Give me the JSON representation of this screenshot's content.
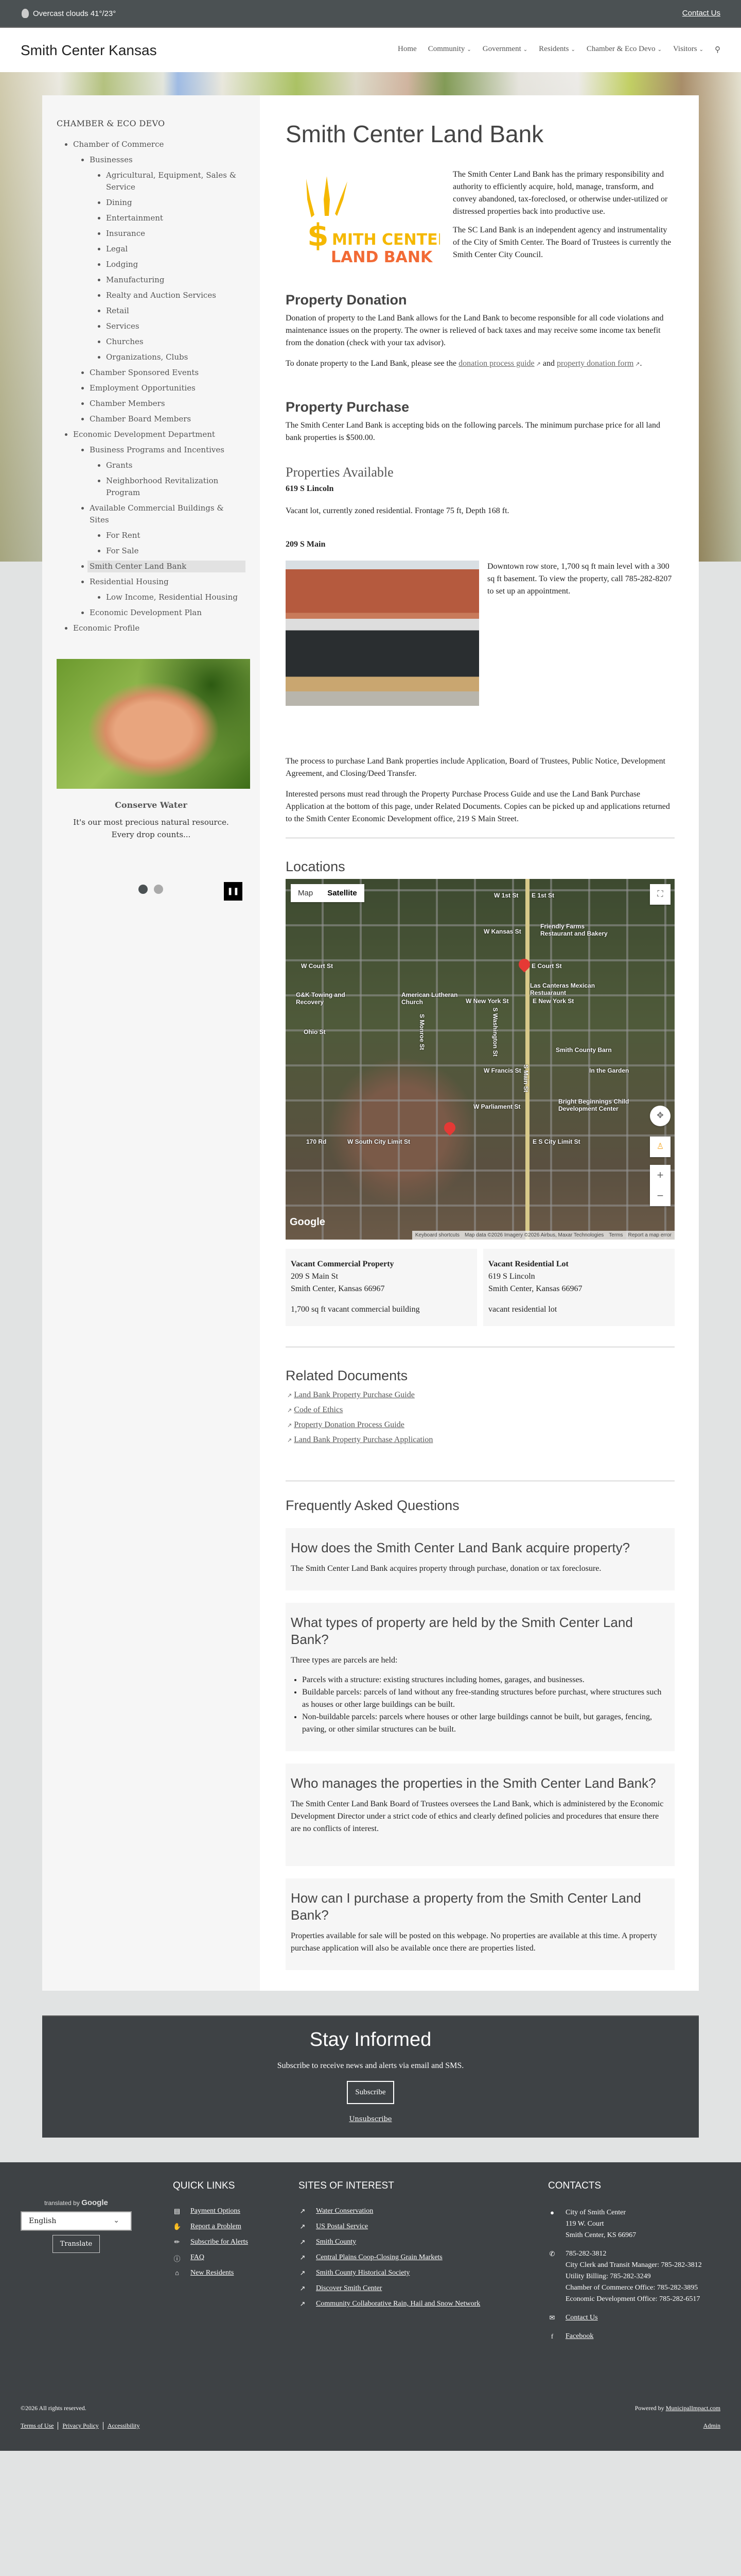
{
  "topbar": {
    "weather": "Overcast clouds 41°/23°",
    "contact": "Contact Us"
  },
  "header": {
    "title": "Smith Center Kansas",
    "nav": [
      "Home",
      "Community",
      "Government",
      "Residents",
      "Chamber & Eco Devo",
      "Visitors"
    ]
  },
  "sidebar": {
    "title": "CHAMBER & ECO DEVO",
    "l1": [
      "Chamber of Commerce",
      "Economic Development Department",
      "Economic Profile"
    ],
    "chamber": [
      "Businesses",
      "Chamber Sponsored Events",
      "Employment Opportunities",
      "Chamber Members",
      "Chamber Board Members"
    ],
    "businesses": [
      "Agricultural, Equipment, Sales & Service",
      "Dining",
      "Entertainment",
      "Insurance",
      "Legal",
      "Lodging",
      "Manufacturing",
      "Realty and Auction Services",
      "Retail",
      "Services",
      "Churches",
      "Organizations, Clubs"
    ],
    "eco": [
      "Business Programs and Incentives",
      "Available Commercial Buildings & Sites",
      "Smith Center Land Bank",
      "Residential Housing",
      "Economic Development Plan"
    ],
    "programs": [
      "Grants",
      "Neighborhood Revitalization Program"
    ],
    "sites": [
      "For Rent",
      "For Sale"
    ],
    "housing": [
      "Low Income, Residential Housing"
    ],
    "promo": {
      "title": "Conserve Water",
      "text": "It's our most precious natural resource.  Every drop counts..."
    },
    "slides": {
      "count": 2,
      "active": 1
    }
  },
  "main": {
    "title": "Smith Center Land Bank",
    "logo": {
      "line1": "SMITH CENTER",
      "line2": "LAND BANK"
    },
    "intro": [
      "The Smith Center Land Bank has the primary responsibility and authority to efficiently acquire, hold, manage, transform, and convey abandoned, tax-foreclosed, or otherwise under-utilized or distressed properties back into productive use.",
      "The SC Land Bank is an independent agency and instrumentality of the City of Smith Center. The Board of Trustees is currently the Smith Center City Council."
    ],
    "donation": {
      "heading": "Property Donation",
      "p1": "Donation of property to the Land Bank allows for the Land Bank to become responsible for all code violations and maintenance issues on the property. The owner is relieved of back taxes and may receive some income tax benefit from the donation (check with your tax advisor).",
      "p2a": "To donate property to the Land Bank, please see the ",
      "link1": "donation process guide",
      "p2b": " and ",
      "link2": "property donation form",
      "p2c": "."
    },
    "purchase": {
      "heading": "Property Purchase",
      "p1": "The Smith Center Land Bank is accepting bids on the following parcels. The minimum purchase price for all land bank properties is $500.00."
    },
    "available": {
      "heading": "Properties Available",
      "p1": {
        "addr": "619 S Lincoln",
        "desc": "Vacant lot, currently zoned residential. Frontage 75 ft, Depth 168 ft."
      },
      "p2": {
        "addr": "209 S Main",
        "desc": "Downtown row store, 1,700 sq ft main level with a 300 sq ft basement. To view the property, call 785-282-8207 to set up an appointment."
      }
    },
    "process": [
      "The process to purchase Land Bank properties include Application, Board of Trustees, Public Notice, Development Agreement, and Closing/Deed Transfer.",
      "Interested persons must read through the Property Purchase Process Guide and use the Land Bank Purchase Application at the bottom of this page, under Related Documents. Copies can be picked up and applications returned to the Smith Center Economic Development office, 219 S Main Street."
    ],
    "locations": {
      "heading": "Locations",
      "map": {
        "type_map": "Map",
        "type_sat": "Satellite",
        "google": "Google",
        "attr": [
          "Keyboard shortcuts",
          "Map data ©2026 Imagery ©2026 Airbus, Maxar Technologies",
          "Terms",
          "Report a map error"
        ],
        "labels": [
          "W 1st St",
          "E 1st St",
          "W Kansas St",
          "Friendly Farms Restaurant and Bakery",
          "W Court St",
          "E Court St",
          "Las Canteras Mexican Restuaraunt",
          "G&K Towing and Recovery",
          "American Lutheran Church",
          "W New York St",
          "E New York St",
          "Ohio St",
          "Smith County Barn",
          "W Francis St",
          "In the Garden",
          "W Parliament St",
          "Bright Beginnings Child Development Center",
          "W South City Limit St",
          "E S City Limit St",
          "170 Rd",
          "S Main St",
          "S Monroe St",
          "S Washington St"
        ]
      },
      "cards": [
        {
          "name": "Vacant Commercial Property",
          "addr1": "209 S Main St",
          "addr2": "Smith Center, Kansas 66967",
          "desc": "1,700 sq ft vacant commercial building"
        },
        {
          "name": "Vacant Residential Lot",
          "addr1": "619 S Lincoln",
          "addr2": "Smith Center, Kansas 66967",
          "desc": "vacant residential lot"
        }
      ]
    },
    "docs": {
      "heading": "Related Documents",
      "items": [
        "Land Bank Property Purchase Guide",
        "Code of Ethics",
        "Property Donation Process Guide",
        "Land Bank Property Purchase Application"
      ]
    },
    "faq": {
      "heading": "Frequently Asked Questions",
      "items": [
        {
          "q": "How does the Smith Center Land Bank acquire property?",
          "a": "The Smith Center Land Bank acquires property through purchase, donation or tax foreclosure."
        },
        {
          "q": "What types of property are held by the Smith Center Land Bank?",
          "a": "Three types are parcels are held:",
          "list": [
            "Parcels with a structure: existing structures including homes, garages, and businesses.",
            "Buildable parcels: parcels of land without any free-standing structures before purchast, where structures such as houses or other large buildings can be built.",
            "Non-buildable parcels: parcels where houses or other large buildings cannot be built, but garages, fencing, paving, or other similar structures can be built."
          ]
        },
        {
          "q": "Who manages the properties in the Smith Center Land Bank?",
          "a": "The Smith Center Land Bank Board of Trustees oversees the Land Bank, which is administered by the Economic Development Director under a strict code of ethics and clearly defined policies and procedures that ensure there are no conflicts of interest."
        },
        {
          "q": "How can I purchase a property from the Smith Center Land Bank?",
          "a": "Properties available for sale will be posted on this webpage. No properties are available at this time. A property purchase application will also be available once there are properties listed."
        }
      ]
    }
  },
  "stay": {
    "title": "Stay Informed",
    "text": "Subscribe to receive news and alerts via email and SMS.",
    "subscribe": "Subscribe",
    "unsubscribe": "Unsubscribe"
  },
  "footer": {
    "translate": {
      "by": "translated by",
      "google": "Google",
      "lang": "English",
      "button": "Translate"
    },
    "quick": {
      "title": "QUICK LINKS",
      "items": [
        "Payment Options",
        "Report a Problem",
        "Subscribe for Alerts",
        "FAQ",
        "New Residents"
      ]
    },
    "sites": {
      "title": "SITES OF INTEREST",
      "items": [
        "Water Conservation",
        "US Postal Service",
        "Smith County",
        "Central Plains Coop-Closing Grain Markets",
        "Smith County Historical Society",
        "Discover Smith Center",
        "Community Collaborative Rain, Hail and Snow Network"
      ]
    },
    "contacts": {
      "title": "CONTACTS",
      "address": [
        "City of Smith Center",
        "119 W. Court",
        "Smith Center, KS 66967"
      ],
      "phones": [
        "785-282-3812",
        "City Clerk and Transit Manager: 785-282-3812",
        "Utility Billing: 785-282-3249",
        "Chamber of Commerce Office: 785-282-3895",
        "Economic Development Office: 785-282-6517"
      ],
      "contact": "Contact Us",
      "facebook": "Facebook"
    },
    "copyright": "©2026 All rights reserved.",
    "powered": "Powered by ",
    "powered_link": "MunicipalImpact.com",
    "links": [
      "Terms of Use",
      "Privacy Policy",
      "Accessibility"
    ],
    "admin": "Admin"
  },
  "colors": {
    "dark": "#3e4245",
    "topbar": "#4b5153",
    "logo_gold": "#f5b800",
    "logo_orange": "#f26a35"
  }
}
